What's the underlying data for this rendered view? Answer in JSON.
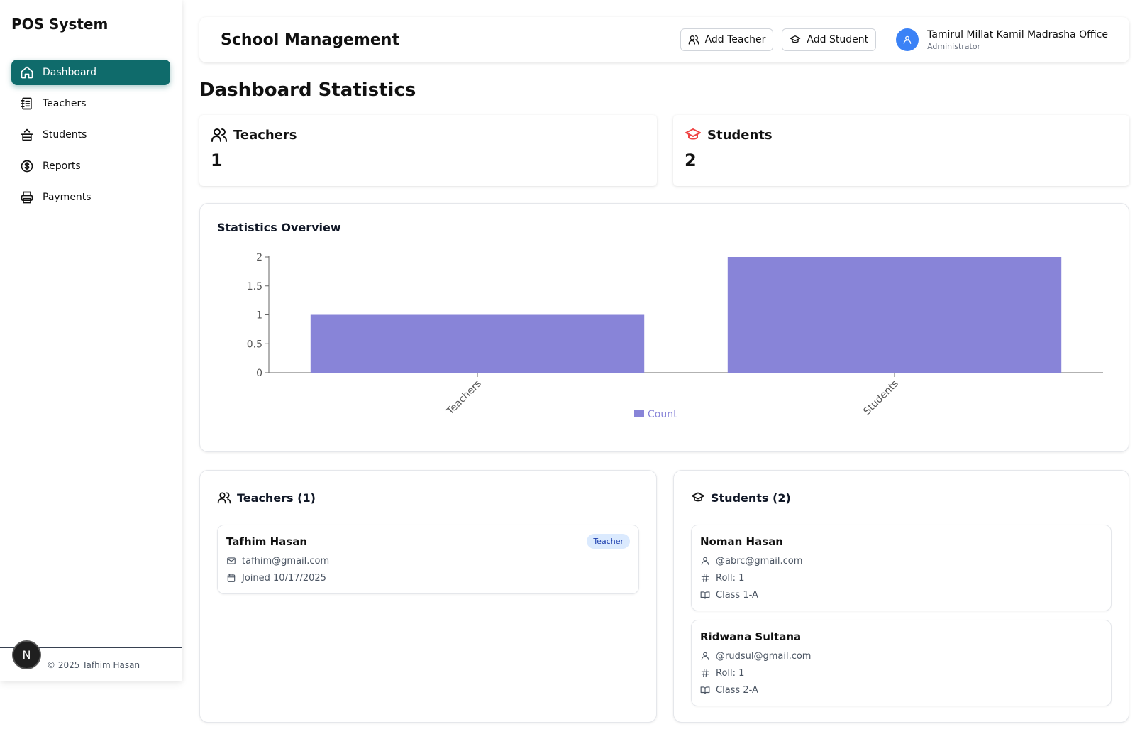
{
  "sidebar": {
    "brand": "POS System",
    "items": [
      {
        "label": "Dashboard",
        "icon": "home-icon",
        "active": true
      },
      {
        "label": "Teachers",
        "icon": "notebook-icon"
      },
      {
        "label": "Students",
        "icon": "basket-icon"
      },
      {
        "label": "Reports",
        "icon": "dollar-circle-icon"
      },
      {
        "label": "Payments",
        "icon": "printer-icon"
      }
    ],
    "footer": "© 2025 Tafhim Hasan",
    "badge": "N"
  },
  "header": {
    "title": "School Management",
    "add_teacher": "Add Teacher",
    "add_student": "Add Student",
    "user_name": "Tamirul Millat Kamil Madrasha Office",
    "user_role": "Administrator"
  },
  "page_title": "Dashboard Statistics",
  "stats": {
    "teachers": {
      "label": "Teachers",
      "value": "1"
    },
    "students": {
      "label": "Students",
      "value": "2"
    }
  },
  "colors": {
    "accent": "#0f6b6b",
    "bar": "#8884d8",
    "avatar": "#3b82f6",
    "students_icon": "#ef4444"
  },
  "chart_title": "Statistics Overview",
  "chart_data": {
    "type": "bar",
    "categories": [
      "Teachers",
      "Students"
    ],
    "series": [
      {
        "name": "Count",
        "values": [
          1,
          2
        ]
      }
    ],
    "yticks": [
      "0",
      "0.5",
      "1",
      "1.5",
      "2"
    ],
    "ylim": [
      0,
      2
    ],
    "legend": "bottom",
    "grid": false
  },
  "teachers_list": {
    "title": "Teachers (1)",
    "items": [
      {
        "name": "Tafhim Hasan",
        "email": "tafhim@gmail.com",
        "joined": "Joined 10/17/2025",
        "tag": "Teacher"
      }
    ]
  },
  "students_list": {
    "title": "Students (2)",
    "items": [
      {
        "name": "Noman Hasan",
        "email": "@abrc@gmail.com",
        "roll": "Roll: 1",
        "class": "Class 1-A"
      },
      {
        "name": "Ridwana Sultana",
        "email": "@rudsul@gmail.com",
        "roll": "Roll: 1",
        "class": "Class 2-A"
      }
    ]
  }
}
